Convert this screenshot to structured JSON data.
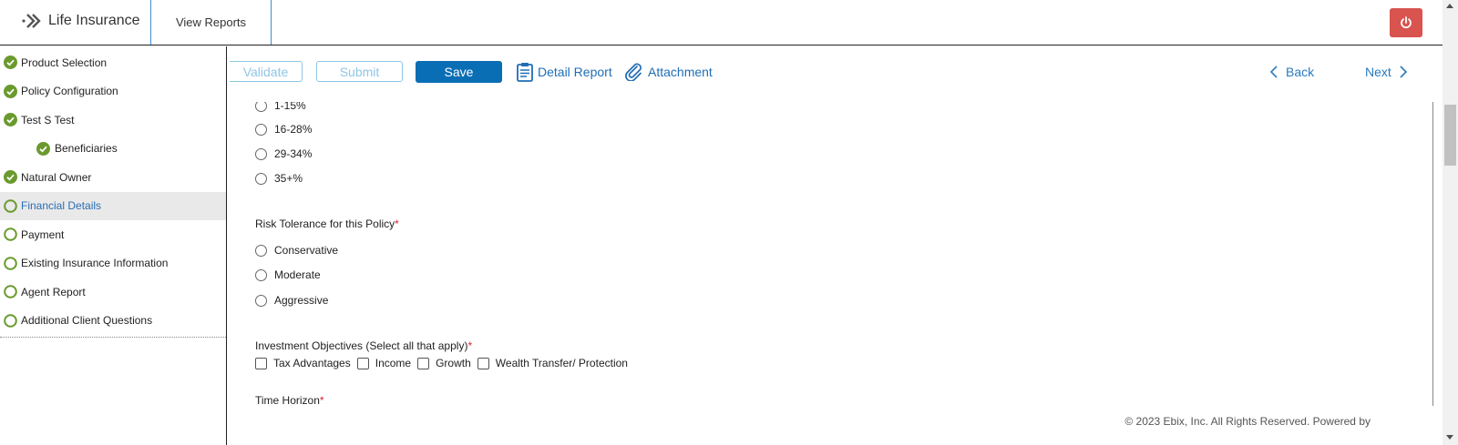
{
  "header": {
    "app_title": "Life Insurance",
    "view_reports": "View Reports",
    "power_icon": "power-icon",
    "power_color": "#d9534f"
  },
  "sidebar": {
    "items": [
      {
        "label": "Product Selection",
        "status": "complete"
      },
      {
        "label": "Policy Configuration",
        "status": "complete"
      },
      {
        "label": "Test S Test",
        "status": "complete"
      },
      {
        "label": "Beneficiaries",
        "status": "complete",
        "sub": true
      },
      {
        "label": "Natural Owner",
        "status": "complete"
      },
      {
        "label": "Financial Details",
        "status": "pending",
        "active": true
      },
      {
        "label": "Payment",
        "status": "pending"
      },
      {
        "label": "Existing Insurance Information",
        "status": "pending"
      },
      {
        "label": "Agent Report",
        "status": "pending"
      },
      {
        "label": "Additional Client Questions",
        "status": "pending"
      }
    ],
    "complete_color": "#6a9a2e"
  },
  "toolbar": {
    "validate": "Validate",
    "submit": "Submit",
    "save": "Save",
    "detail_report": "Detail Report",
    "attachment": "Attachment",
    "back": "Back",
    "next": "Next"
  },
  "form": {
    "tax_bracket_options": [
      "1-15%",
      "16-28%",
      "29-34%",
      "35+%"
    ],
    "risk_tolerance": {
      "label": "Risk Tolerance for this Policy",
      "required": "*",
      "options": [
        "Conservative",
        "Moderate",
        "Aggressive"
      ]
    },
    "investment_objectives": {
      "label": "Investment Objectives (Select all that apply)",
      "required": "*",
      "options": [
        "Tax Advantages",
        "Income",
        "Growth",
        "Wealth Transfer/ Protection"
      ]
    },
    "time_horizon": {
      "label": "Time Horizon",
      "required": "*"
    }
  },
  "footer": {
    "text": "© 2023 Ebix, Inc. All Rights Reserved. Powered by"
  }
}
